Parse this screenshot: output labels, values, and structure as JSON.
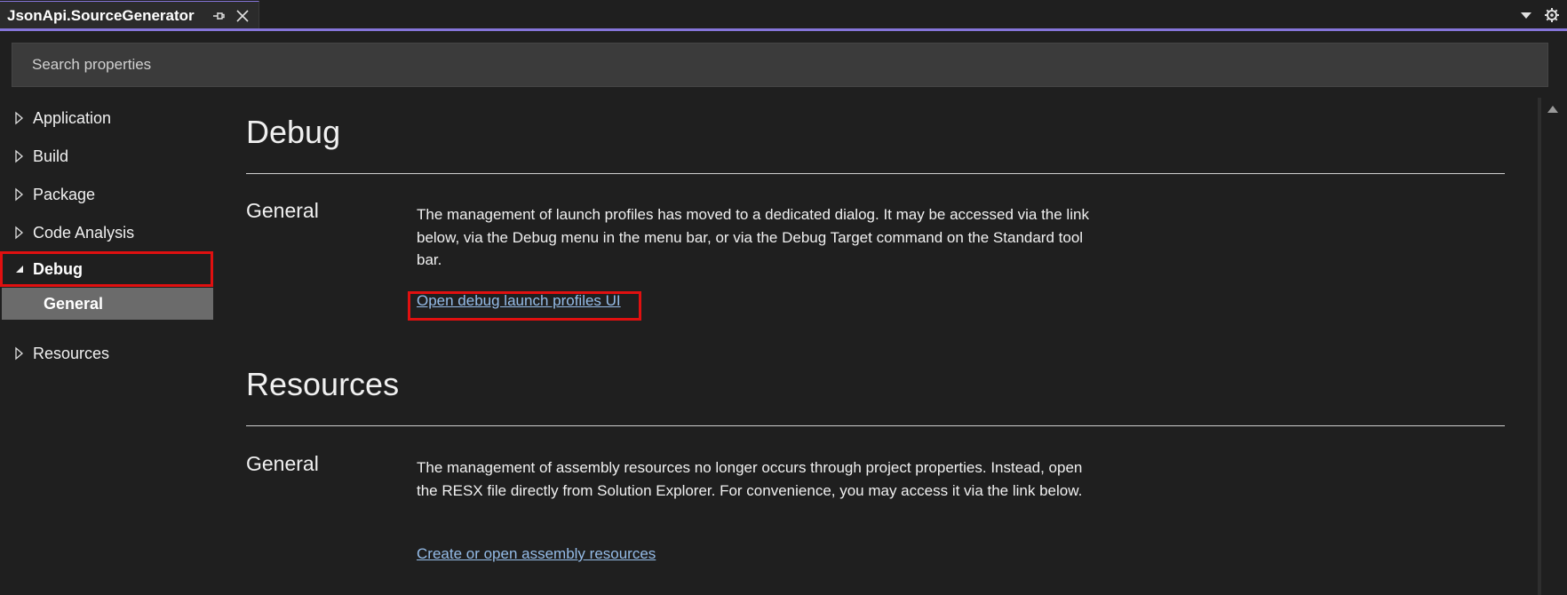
{
  "tab": {
    "title": "JsonApi.SourceGenerator",
    "pin_icon": "pin-icon",
    "close_icon": "close-icon"
  },
  "toolbar": {
    "dropdown_icon": "chevron-down-icon",
    "settings_icon": "gear-icon"
  },
  "search": {
    "placeholder": "Search properties",
    "value": ""
  },
  "sidebar": {
    "items": [
      {
        "label": "Application",
        "expanded": false
      },
      {
        "label": "Build",
        "expanded": false
      },
      {
        "label": "Package",
        "expanded": false
      },
      {
        "label": "Code Analysis",
        "expanded": false
      },
      {
        "label": "Debug",
        "expanded": true,
        "selected": true
      },
      {
        "label": "Resources",
        "expanded": false
      }
    ],
    "debug_children": [
      {
        "label": "General",
        "selected": true
      }
    ]
  },
  "content": {
    "sections": [
      {
        "title": "Debug",
        "group_title": "General",
        "text": "The management of launch profiles has moved to a dedicated dialog. It may be accessed via the link below, via the Debug menu in the menu bar, or via the Debug Target command on the Standard tool bar.",
        "link": "Open debug launch profiles UI"
      },
      {
        "title": "Resources",
        "group_title": "General",
        "text": "The management of assembly resources no longer occurs through project properties. Instead, open the RESX file directly from Solution Explorer. For convenience, you may access it via the link below.",
        "link": "Create or open assembly resources"
      }
    ]
  },
  "colors": {
    "background": "#1f1f1f",
    "accent": "#8575d9",
    "highlight": "#e01010",
    "link": "#95bce8",
    "selected_item": "#6b6b6b"
  }
}
